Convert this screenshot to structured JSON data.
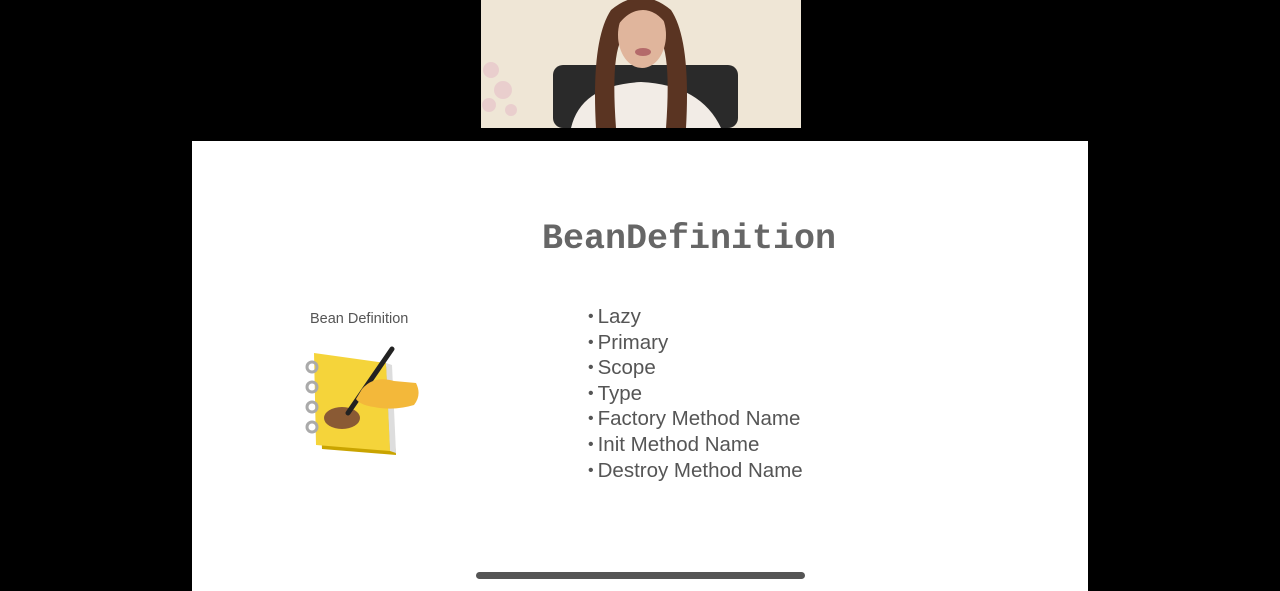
{
  "video": {
    "participant_icon": "webcam-feed"
  },
  "slide": {
    "title": "BeanDefinition",
    "caption": "Bean Definition",
    "icon": "notebook-with-pen-and-bean-icon",
    "bullets": [
      "Lazy",
      "Primary",
      "Scope",
      "Type",
      "Factory Method Name",
      "Init Method Name",
      "Destroy Method Name"
    ]
  },
  "colors": {
    "background": "#000000",
    "slide": "#ffffff",
    "text": "#555555"
  }
}
